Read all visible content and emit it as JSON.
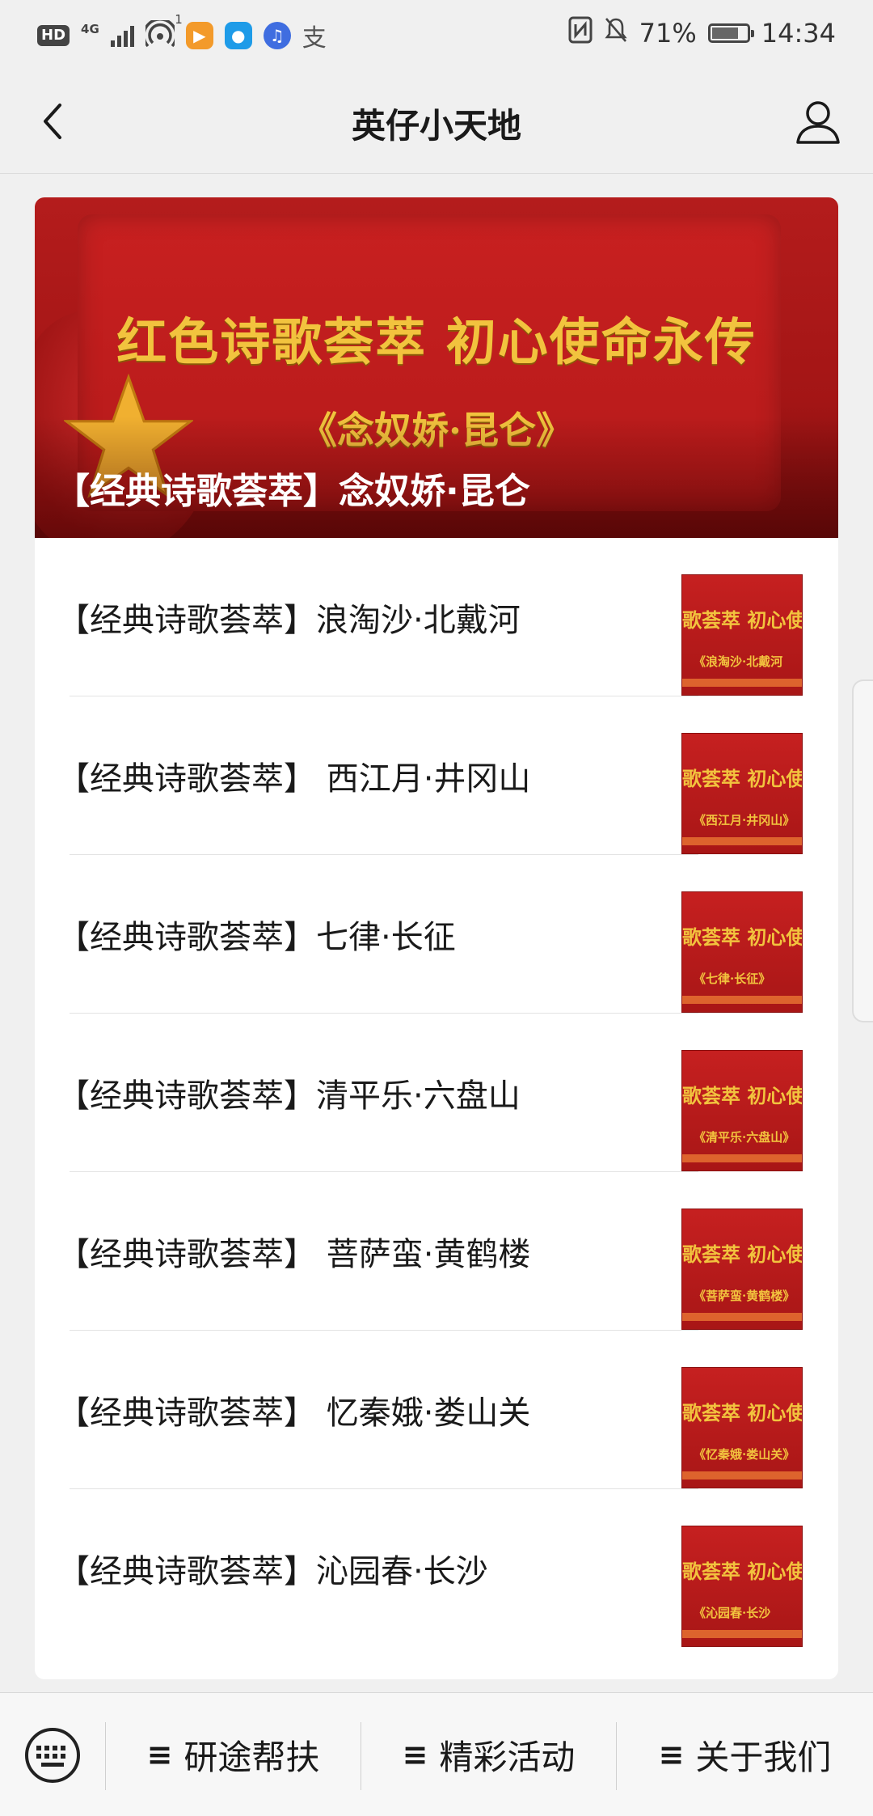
{
  "status_bar": {
    "hd": "HD",
    "network": "4G",
    "network_sub": "1",
    "battery": "71%",
    "time": "14:34",
    "icons": [
      "hd-icon",
      "signal-icon",
      "hotspot-icon",
      "video-app-icon",
      "bulb-app-icon",
      "music-app-icon",
      "alipay-icon",
      "nfc-icon",
      "mute-icon",
      "battery-icon"
    ]
  },
  "nav": {
    "title": "英仔小天地",
    "back_icon": "back-icon",
    "profile_icon": "user-icon"
  },
  "banner": {
    "headline": "红色诗歌荟萃 初心使命永传",
    "subtitle": "《念奴娇·昆仑》",
    "caption": "【经典诗歌荟萃】念奴娇·昆仑"
  },
  "articles": [
    {
      "title": "【经典诗歌荟萃】浪淘沙·北戴河",
      "thumb_line1": "歌荟萃 初心使",
      "thumb_line2": "《浪淘沙·北戴河"
    },
    {
      "title": "【经典诗歌荟萃】 西江月·井冈山",
      "thumb_line1": "歌荟萃 初心使命",
      "thumb_line2": "《西江月·井冈山》"
    },
    {
      "title": "【经典诗歌荟萃】七律·长征",
      "thumb_line1": "歌荟萃 初心使命",
      "thumb_line2": "《七律·长征》"
    },
    {
      "title": "【经典诗歌荟萃】清平乐·六盘山",
      "thumb_line1": "歌荟萃 初心使命",
      "thumb_line2": "《清平乐·六盘山》"
    },
    {
      "title": "【经典诗歌荟萃】 菩萨蛮·黄鹤楼",
      "thumb_line1": "歌荟萃 初心使命",
      "thumb_line2": "《菩萨蛮·黄鹤楼》"
    },
    {
      "title": "【经典诗歌荟萃】 忆秦娥·娄山关",
      "thumb_line1": "歌荟萃 初心使命",
      "thumb_line2": "《忆秦娥·娄山关》"
    },
    {
      "title": "【经典诗歌荟萃】沁园春·长沙",
      "thumb_line1": "歌荟萃 初心使",
      "thumb_line2": "《沁园春·长沙"
    }
  ],
  "bottom_menu": {
    "keyboard_icon": "keyboard-icon",
    "items": [
      {
        "label": "研途帮扶",
        "icon": "≡"
      },
      {
        "label": "精彩活动",
        "icon": "≡"
      },
      {
        "label": "关于我们",
        "icon": "≡"
      }
    ]
  },
  "colors": {
    "accent_red": "#b51a1a",
    "gold": "#f2c33e",
    "background": "#f0f0f0"
  }
}
